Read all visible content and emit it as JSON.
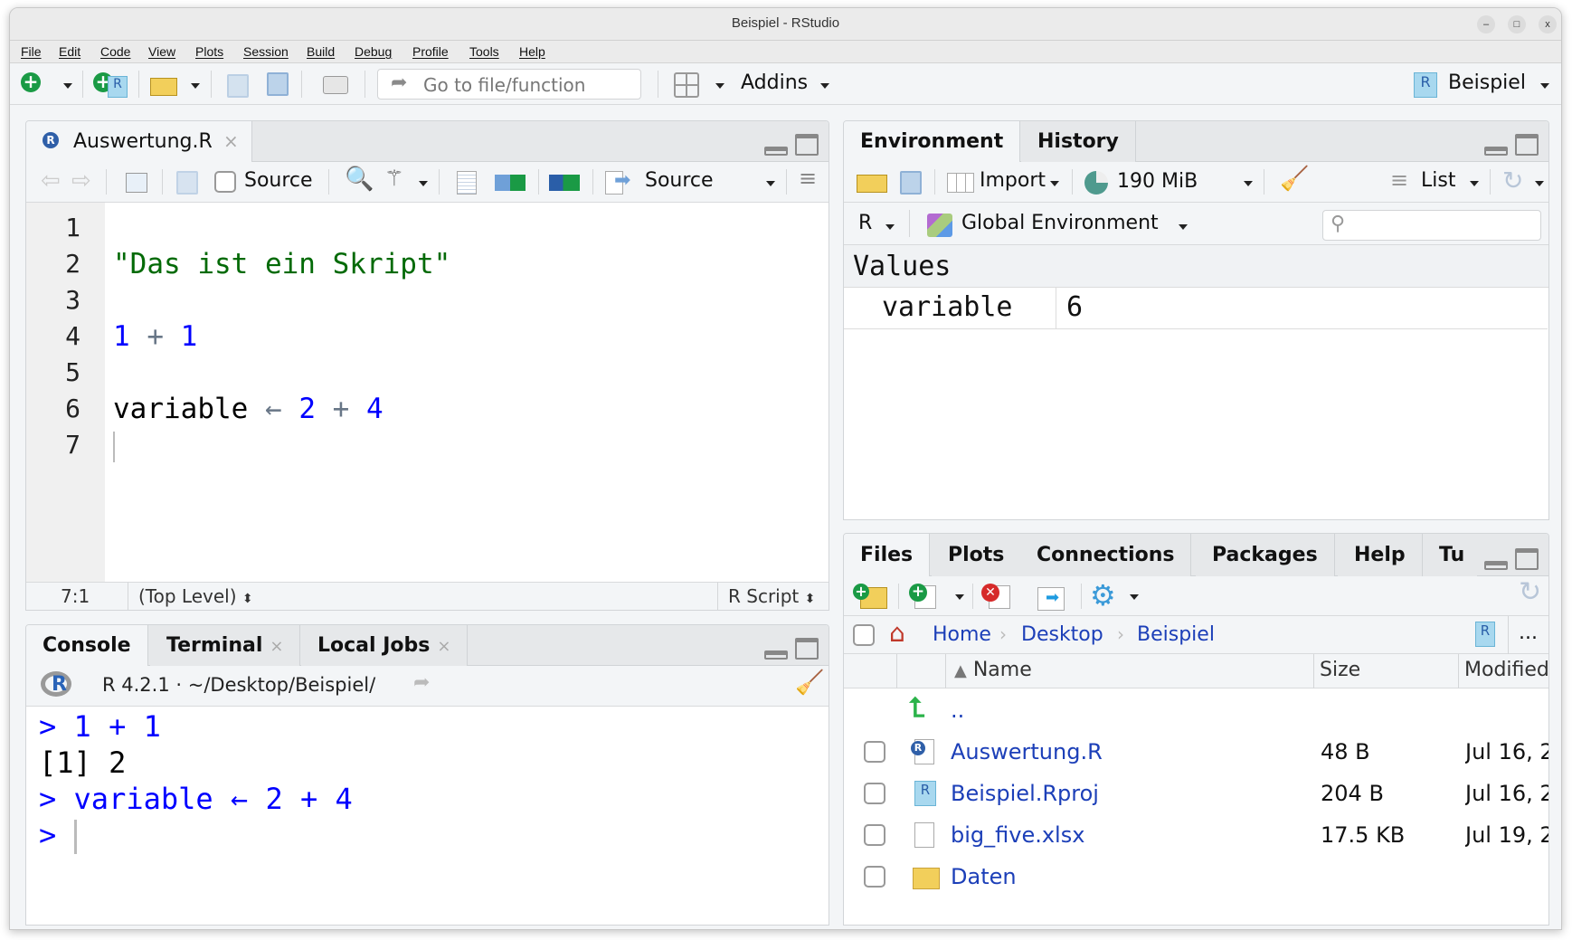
{
  "window": {
    "title": "Beispiel - RStudio",
    "minimize": "–",
    "maximize": "□",
    "close": "x"
  },
  "menu": [
    "File",
    "Edit",
    "Code",
    "View",
    "Plots",
    "Session",
    "Build",
    "Debug",
    "Profile",
    "Tools",
    "Help"
  ],
  "toolbar": {
    "goto_placeholder": "Go to file/function",
    "addins": "Addins",
    "project": "Beispiel"
  },
  "source": {
    "tab": "Auswertung.R",
    "tab_close": "×",
    "source_on_save": "Source",
    "source_button": "Source",
    "lines": [
      {
        "n": "1",
        "tokens": []
      },
      {
        "n": "2",
        "tokens": [
          {
            "t": "\"Das ist ein Skript\"",
            "c": "str"
          }
        ]
      },
      {
        "n": "3",
        "tokens": []
      },
      {
        "n": "4",
        "tokens": [
          {
            "t": "1",
            "c": "num"
          },
          {
            "t": " + ",
            "c": "op"
          },
          {
            "t": "1",
            "c": "num"
          }
        ]
      },
      {
        "n": "5",
        "tokens": []
      },
      {
        "n": "6",
        "tokens": [
          {
            "t": "variable ",
            "c": "kw"
          },
          {
            "t": "←",
            "c": "op"
          },
          {
            "t": " 2",
            "c": "num"
          },
          {
            "t": " + ",
            "c": "op"
          },
          {
            "t": "4",
            "c": "num"
          }
        ]
      },
      {
        "n": "7",
        "tokens": []
      }
    ],
    "status": {
      "position": "7:1",
      "scope": "(Top Level)",
      "filetype": "R Script"
    }
  },
  "console": {
    "tabs": [
      {
        "label": "Console"
      },
      {
        "label": "Terminal",
        "close": "×"
      },
      {
        "label": "Local Jobs",
        "close": "×"
      }
    ],
    "info": "R 4.2.1 · ~/Desktop/Beispiel/",
    "lines": [
      {
        "text": "> 1 + 1",
        "c": "blue"
      },
      {
        "text": "[1] 2",
        "c": "kw"
      },
      {
        "text": "> variable ← 2 + 4",
        "c": "blue"
      },
      {
        "text": "> ",
        "c": "blue"
      }
    ]
  },
  "environment": {
    "tabs": [
      "Environment",
      "History"
    ],
    "import": "Import",
    "memory": "190 MiB",
    "view": "List",
    "language": "R",
    "scope": "Global Environment",
    "search_placeholder": "",
    "section": "Values",
    "values": [
      {
        "name": "variable",
        "value": "6"
      }
    ]
  },
  "files": {
    "tabs": [
      "Files",
      "Plots",
      "Connections",
      "Packages",
      "Help",
      "Tu"
    ],
    "breadcrumb": [
      "Home",
      "Desktop",
      "Beispiel"
    ],
    "more": "...",
    "columns": {
      "name": "Name",
      "size": "Size",
      "modified": "Modified"
    },
    "parent": "..",
    "rows": [
      {
        "name": "Auswertung.R",
        "icon": "r-file-icon",
        "size": "48 B",
        "modified": "Jul 16, 2"
      },
      {
        "name": "Beispiel.Rproj",
        "icon": "rproj-icon",
        "size": "204 B",
        "modified": "Jul 16, 2"
      },
      {
        "name": "big_five.xlsx",
        "icon": "file-icon",
        "size": "17.5 KB",
        "modified": "Jul 19, 2"
      },
      {
        "name": "Daten",
        "icon": "folder-icon",
        "size": "",
        "modified": ""
      }
    ]
  },
  "colors": {
    "string": "#036a07",
    "number": "#0000ff",
    "link": "#1c3fb8",
    "accent_green": "#1a9a45"
  }
}
